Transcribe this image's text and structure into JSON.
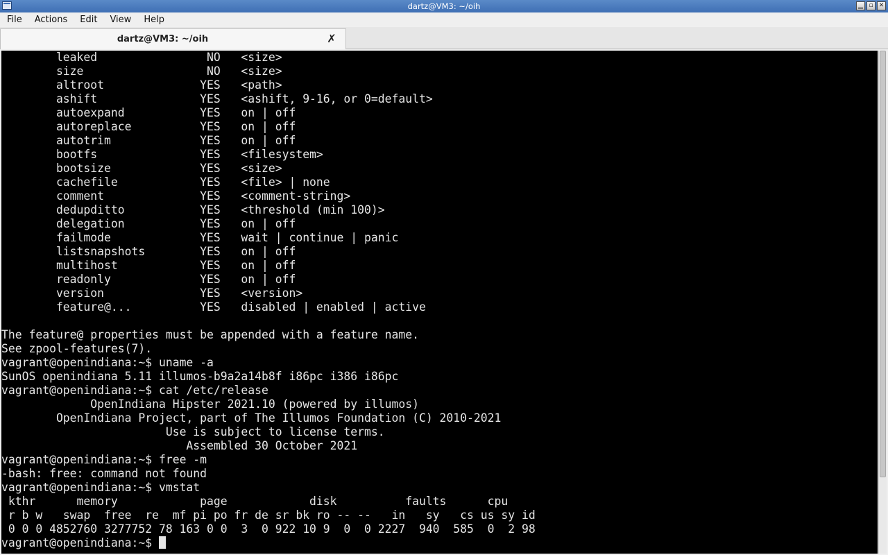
{
  "window": {
    "title": "dartz@VM3: ~/oih",
    "buttons": {
      "minimize": "▁",
      "maximize": "▫",
      "close": "✕"
    }
  },
  "menubar": {
    "items": [
      "File",
      "Actions",
      "Edit",
      "View",
      "Help"
    ]
  },
  "tabs": [
    {
      "label": "dartz@VM3: ~/oih",
      "close_glyph": "✗"
    }
  ],
  "terminal": {
    "lines": [
      "        leaked                NO   <size>",
      "        size                  NO   <size>",
      "        altroot              YES   <path>",
      "        ashift               YES   <ashift, 9-16, or 0=default>",
      "        autoexpand           YES   on | off",
      "        autoreplace          YES   on | off",
      "        autotrim             YES   on | off",
      "        bootfs               YES   <filesystem>",
      "        bootsize             YES   <size>",
      "        cachefile            YES   <file> | none",
      "        comment              YES   <comment-string>",
      "        dedupditto           YES   <threshold (min 100)>",
      "        delegation           YES   on | off",
      "        failmode             YES   wait | continue | panic",
      "        listsnapshots        YES   on | off",
      "        multihost            YES   on | off",
      "        readonly             YES   on | off",
      "        version              YES   <version>",
      "        feature@...          YES   disabled | enabled | active",
      "",
      "The feature@ properties must be appended with a feature name.",
      "See zpool-features(7).",
      "vagrant@openindiana:~$ uname -a",
      "SunOS openindiana 5.11 illumos-b9a2a14b8f i86pc i386 i86pc",
      "vagrant@openindiana:~$ cat /etc/release",
      "             OpenIndiana Hipster 2021.10 (powered by illumos)",
      "        OpenIndiana Project, part of The Illumos Foundation (C) 2010-2021",
      "                        Use is subject to license terms.",
      "                           Assembled 30 October 2021",
      "vagrant@openindiana:~$ free -m",
      "-bash: free: command not found",
      "vagrant@openindiana:~$ vmstat",
      " kthr      memory            page            disk          faults      cpu",
      " r b w   swap  free  re  mf pi po fr de sr bk ro -- --   in   sy   cs us sy id",
      " 0 0 0 4852760 3277752 78 163 0 0  3  0 922 10 9  0  0 2227  940  585  0  2 98"
    ],
    "prompt": "vagrant@openindiana:~$ "
  },
  "colors": {
    "terminal_bg": "#000000",
    "terminal_fg": "#e5e5e5",
    "titlebar": "#4a7bbf"
  }
}
